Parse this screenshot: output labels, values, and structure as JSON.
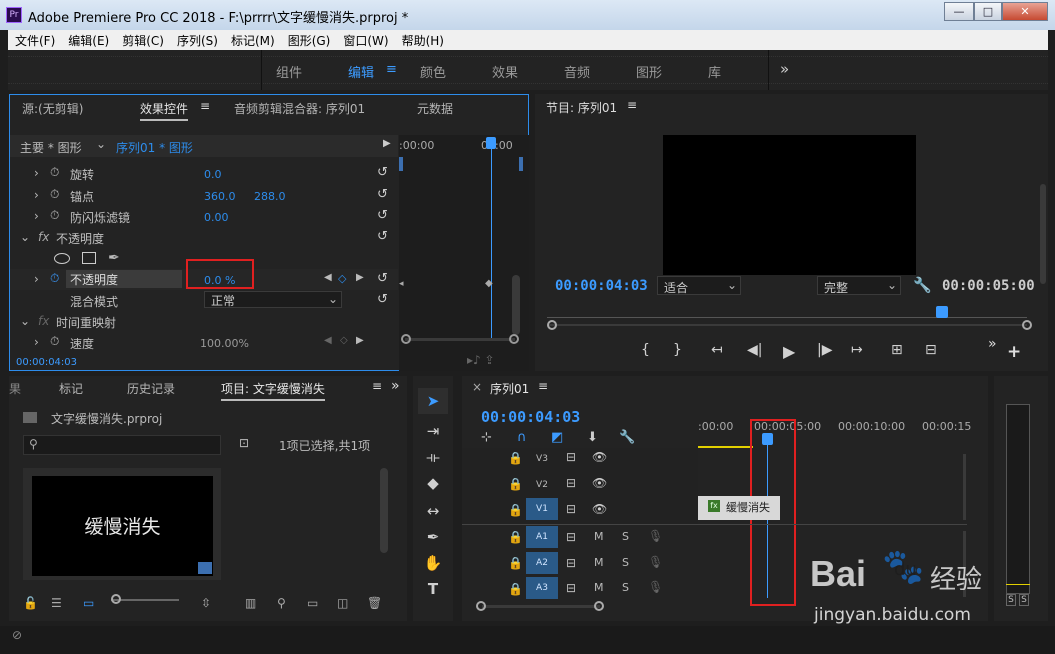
{
  "window": {
    "app_icon": "Pr",
    "title": "Adobe Premiere Pro CC 2018 - F:\\prrrr\\文字缓慢消失.prproj *",
    "min": "—",
    "max": "□",
    "close": "✕"
  },
  "menu": [
    "文件(F)",
    "编辑(E)",
    "剪辑(C)",
    "序列(S)",
    "标记(M)",
    "图形(G)",
    "窗口(W)",
    "帮助(H)"
  ],
  "workspaces": [
    "组件",
    "编辑",
    "颜色",
    "效果",
    "音频",
    "图形",
    "库"
  ],
  "workspace_active": "编辑",
  "workspace_more": "»",
  "effect_controls": {
    "tabs": [
      "源:(无剪辑)",
      "效果控件",
      "音频剪辑混合器: 序列01",
      "元数据"
    ],
    "master": "主要 * 图形",
    "seq": "序列01 * 图形",
    "ruler_time": ":00:00",
    "ruler_time2": "00:00",
    "rows": [
      {
        "name": "旋转",
        "v1": "0.0"
      },
      {
        "name": "锚点",
        "v1": "360.0",
        "v2": "288.0"
      },
      {
        "name": "防闪烁滤镜",
        "v1": "0.00"
      }
    ],
    "fx_label": "fx",
    "opacity_group": "不透明度",
    "opacity_name": "不透明度",
    "opacity_value": "0.0 %",
    "blend_label": "混合模式",
    "blend_value": "正常",
    "time_remap": "时间重映射",
    "speed_name": "速度",
    "speed_value": "100.00%",
    "timecode": "00:00:04:03"
  },
  "program": {
    "title": "节目: 序列01",
    "timecode": "00:00:04:03",
    "fit": "适合",
    "quality": "完整",
    "duration": "00:00:05:00"
  },
  "project": {
    "tabs": [
      "标记",
      "历史记录",
      "项目: 文字缓慢消失"
    ],
    "file": "文字缓慢消失.prproj",
    "selection": "1项已选择,共1项",
    "thumb_text": "缓慢消失"
  },
  "timeline": {
    "tab": "序列01",
    "timecode": "00:00:04:03",
    "ruler": [
      ":00:00",
      "00:00:05:00",
      "00:00:10:00",
      "00:00:15"
    ],
    "video_tracks": [
      "V3",
      "V2",
      "V1"
    ],
    "audio_tracks": [
      "A1",
      "A2",
      "A3"
    ],
    "clip_label": "缓慢消失",
    "clip_fx": "fx",
    "m": "M",
    "s": "S"
  },
  "watermark": {
    "brand": "Bai",
    "brand2": "du",
    "jingyan": "经验",
    "url": "jingyan.baidu.com"
  },
  "meter": {
    "s1": "S",
    "s2": "S"
  }
}
